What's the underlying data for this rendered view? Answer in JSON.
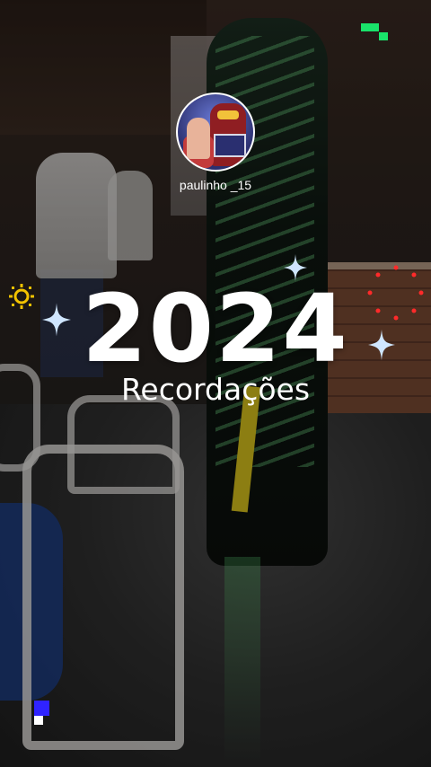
{
  "story": {
    "username": "paulinho _15",
    "year_text": "2024",
    "subtitle": "Recordações"
  },
  "icons": {
    "avatar": "profile-photo-icon",
    "sparkles": "sparkle-icon",
    "sun_badge": "sun-icon",
    "red_dots": "dot-ring-icon",
    "green_pixels": "pixel-deco-icon",
    "blue_pixels": "pixel-deco-icon"
  },
  "colors": {
    "sparkle": "#cfe6ff",
    "sun": "#f2c200",
    "dots": "#ff2a2a",
    "green": "#19e36a",
    "blue": "#2f23ff"
  }
}
